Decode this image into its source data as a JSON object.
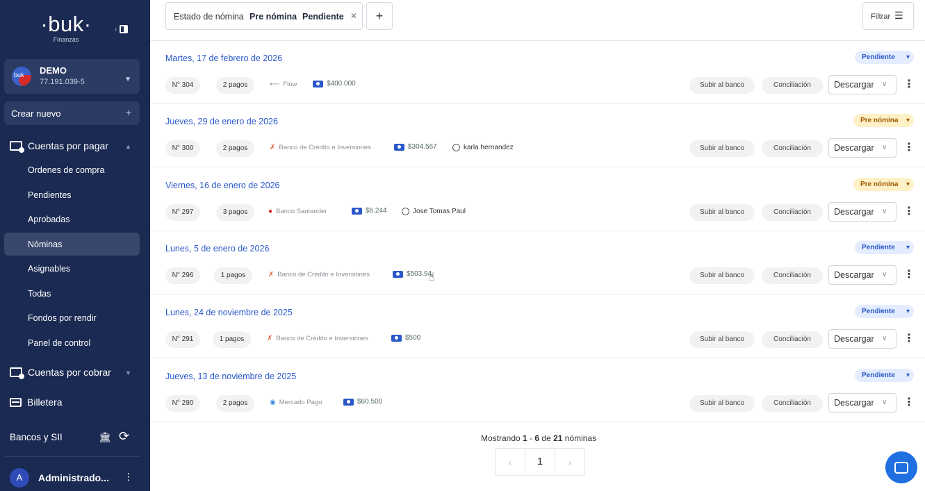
{
  "sidebar": {
    "logo": "·buk·",
    "logo_sub": "Finanzas",
    "collapse_arrow": "‹",
    "company": {
      "avatar_text": "buk",
      "name": "DEMO",
      "rut": "77.191.039-5"
    },
    "create_label": "Crear nuevo",
    "cuentas_pagar": "Cuentas por pagar",
    "items": [
      "Ordenes de compra",
      "Pendientes",
      "Aprobadas",
      "Nóminas",
      "Asignables",
      "Todas",
      "Fondos por rendir",
      "Panel de control"
    ],
    "active_item": "Nóminas",
    "cuentas_cobrar": "Cuentas por cobrar",
    "billetera": "Billetera",
    "bancos": "Bancos y SII",
    "user_initial": "A",
    "user_name": "Administrado..."
  },
  "filters": {
    "label": "Estado de nómina",
    "value1": "Pre nómina",
    "value2": "Pendiente",
    "filter_button": "Filtrar"
  },
  "rows": [
    {
      "date": "Martes, 17 de febrero de 2026",
      "status": "Pendiente",
      "number": "N° 304",
      "payments": "2 pagos",
      "bank": "Flow",
      "amount": "$400.000",
      "assignee": ""
    },
    {
      "date": "Jueves, 29 de enero de 2026",
      "status": "Pre nómina",
      "number": "N° 300",
      "payments": "2 pagos",
      "bank": "Banco de Crédito e Inversiones",
      "amount": "$304.567",
      "assignee": "karla hernandez"
    },
    {
      "date": "Viernes, 16 de enero de 2026",
      "status": "Pre nómina",
      "number": "N° 297",
      "payments": "3 pagos",
      "bank": "Banco Santander",
      "amount": "$6.244",
      "assignee": "Jose Tomas Paul"
    },
    {
      "date": "Lunes, 5 de enero de 2026",
      "status": "Pendiente",
      "number": "N° 296",
      "payments": "1 pagos",
      "bank": "Banco de Crédito e Inversiones",
      "amount": "$503.94",
      "assignee": ""
    },
    {
      "date": "Lunes, 24 de noviembre de 2025",
      "status": "Pendiente",
      "number": "N° 291",
      "payments": "1 pagos",
      "bank": "Banco de Crédito e Inversiones",
      "amount": "$500",
      "assignee": ""
    },
    {
      "date": "Jueves, 13 de noviembre de 2025",
      "status": "Pendiente",
      "number": "N° 290",
      "payments": "2 pagos",
      "bank": "Mercado Pago",
      "amount": "$60.500",
      "assignee": ""
    }
  ],
  "actions": {
    "upload": "Subir al banco",
    "reconcile": "Conciliación",
    "download": "Descargar"
  },
  "pagination": {
    "prefix": "Mostrando ",
    "from": "1",
    "dash": " - ",
    "to": "6",
    "of": " de ",
    "total": "21",
    "suffix": " nóminas",
    "page": "1",
    "prev": "‹",
    "next": "›"
  },
  "colors": {
    "sidebar": "#1b2a52",
    "accent": "#2a58c9",
    "pending_bg": "#e4ecff",
    "pre_bg": "#fff1c7"
  }
}
